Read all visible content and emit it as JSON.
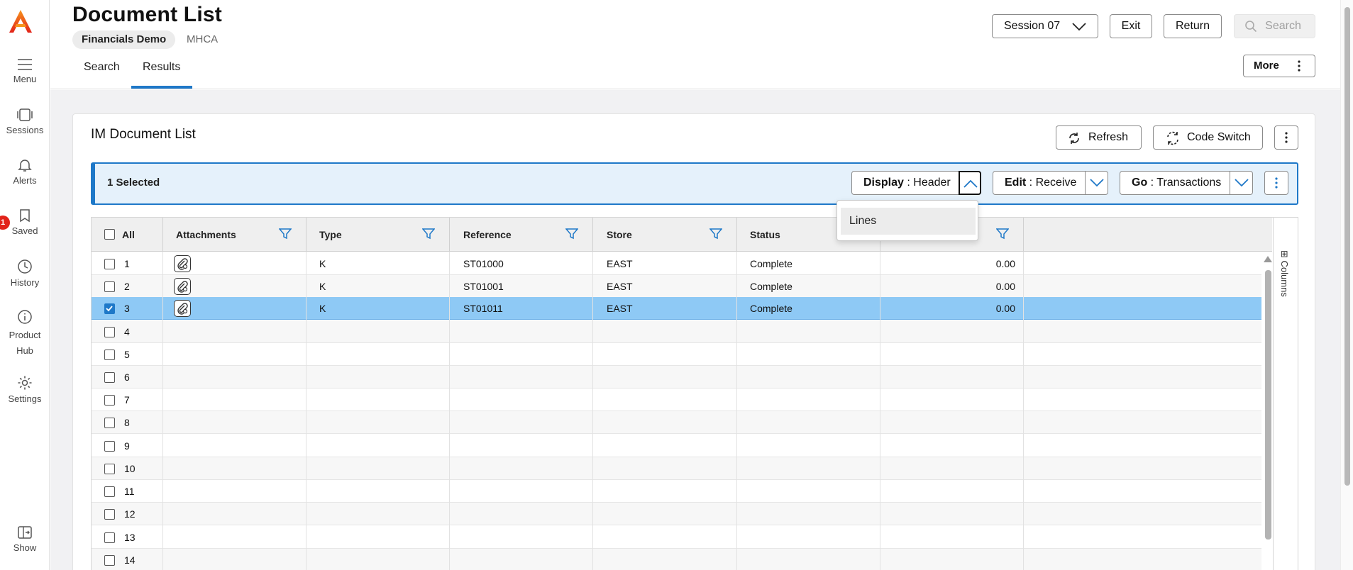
{
  "rail": {
    "items": [
      {
        "label": "Menu"
      },
      {
        "label": "Sessions"
      },
      {
        "label": "Alerts"
      },
      {
        "label": "Saved",
        "badge": "1"
      },
      {
        "label": "History"
      },
      {
        "label": "Product Hub"
      },
      {
        "label": "Settings"
      },
      {
        "label": "Show"
      }
    ]
  },
  "header": {
    "title": "Document List",
    "company_chip": "Financials Demo",
    "company_code": "MHCA",
    "tabs": [
      "Search",
      "Results"
    ],
    "active_tab": "Results",
    "session_label": "Session 07",
    "exit_label": "Exit",
    "return_label": "Return",
    "search_label": "Search",
    "more_label": "More"
  },
  "panel": {
    "title": "IM Document List",
    "refresh_label": "Refresh",
    "code_switch_label": "Code Switch"
  },
  "selection": {
    "count_label": "1 Selected",
    "display_prefix": "Display",
    "display_value": "Header",
    "edit_prefix": "Edit",
    "edit_value": "Receive",
    "go_prefix": "Go",
    "go_value": "Transactions",
    "separator": " : "
  },
  "dropdown": {
    "items": [
      "Lines"
    ]
  },
  "grid": {
    "columns": [
      "All",
      "Attachments",
      "Type",
      "Reference",
      "Store",
      "Status",
      ""
    ],
    "columns_toggle": "Columns",
    "rows": [
      {
        "n": "1",
        "type": "K",
        "reference": "ST01000",
        "store": "EAST",
        "status": "Complete",
        "amount": "0.00",
        "selected": false,
        "attach": true
      },
      {
        "n": "2",
        "type": "K",
        "reference": "ST01001",
        "store": "EAST",
        "status": "Complete",
        "amount": "0.00",
        "selected": false,
        "attach": true
      },
      {
        "n": "3",
        "type": "K",
        "reference": "ST01011",
        "store": "EAST",
        "status": "Complete",
        "amount": "0.00",
        "selected": true,
        "attach": true
      },
      {
        "n": "4",
        "type": "",
        "reference": "",
        "store": "",
        "status": "",
        "amount": "",
        "selected": false,
        "attach": false
      },
      {
        "n": "5",
        "type": "",
        "reference": "",
        "store": "",
        "status": "",
        "amount": "",
        "selected": false,
        "attach": false
      },
      {
        "n": "6",
        "type": "",
        "reference": "",
        "store": "",
        "status": "",
        "amount": "",
        "selected": false,
        "attach": false
      },
      {
        "n": "7",
        "type": "",
        "reference": "",
        "store": "",
        "status": "",
        "amount": "",
        "selected": false,
        "attach": false
      },
      {
        "n": "8",
        "type": "",
        "reference": "",
        "store": "",
        "status": "",
        "amount": "",
        "selected": false,
        "attach": false
      },
      {
        "n": "9",
        "type": "",
        "reference": "",
        "store": "",
        "status": "",
        "amount": "",
        "selected": false,
        "attach": false
      },
      {
        "n": "10",
        "type": "",
        "reference": "",
        "store": "",
        "status": "",
        "amount": "",
        "selected": false,
        "attach": false
      },
      {
        "n": "11",
        "type": "",
        "reference": "",
        "store": "",
        "status": "",
        "amount": "",
        "selected": false,
        "attach": false
      },
      {
        "n": "12",
        "type": "",
        "reference": "",
        "store": "",
        "status": "",
        "amount": "",
        "selected": false,
        "attach": false
      },
      {
        "n": "13",
        "type": "",
        "reference": "",
        "store": "",
        "status": "",
        "amount": "",
        "selected": false,
        "attach": false
      },
      {
        "n": "14",
        "type": "",
        "reference": "",
        "store": "",
        "status": "",
        "amount": "",
        "selected": false,
        "attach": false
      }
    ]
  },
  "colors": {
    "accent": "#1e78c8",
    "selected_row": "#8ec9f5",
    "brand": "#f26522",
    "badge": "#e2231a"
  },
  "icons": {
    "logo": "brand-logo-icon",
    "menu": "hamburger-icon",
    "sessions": "sessions-icon",
    "alerts": "bell-icon",
    "saved": "bookmark-icon",
    "history": "clock-icon",
    "product_hub": "info-icon",
    "settings": "gear-icon",
    "show": "panel-toggle-icon",
    "filter": "filter-icon",
    "attachment": "paperclip-icon"
  }
}
